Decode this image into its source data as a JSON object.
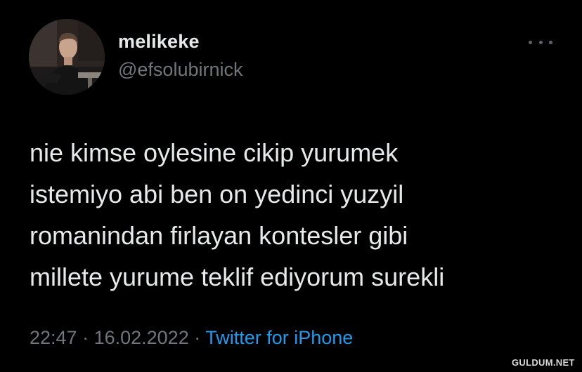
{
  "user": {
    "name": "melikeke",
    "handle": "@efsolubirnick"
  },
  "tweet": {
    "lines": [
      "nie kimse oylesine cikip yurumek",
      "istemiyo abi ben on yedinci yuzyil",
      "romanindan firlayan kontesler gibi",
      "millete yurume teklif ediyorum surekli"
    ],
    "time": "22:47",
    "separator": " · ",
    "date": "16.02.2022",
    "source": "Twitter for iPhone"
  },
  "watermark": "GULDUM.NET",
  "colors": {
    "background": "#000000",
    "text": "#e7e9ea",
    "muted": "#71767b",
    "accent": "#1d9bf0"
  },
  "icons": {
    "more": "more-horizontal-icon"
  }
}
